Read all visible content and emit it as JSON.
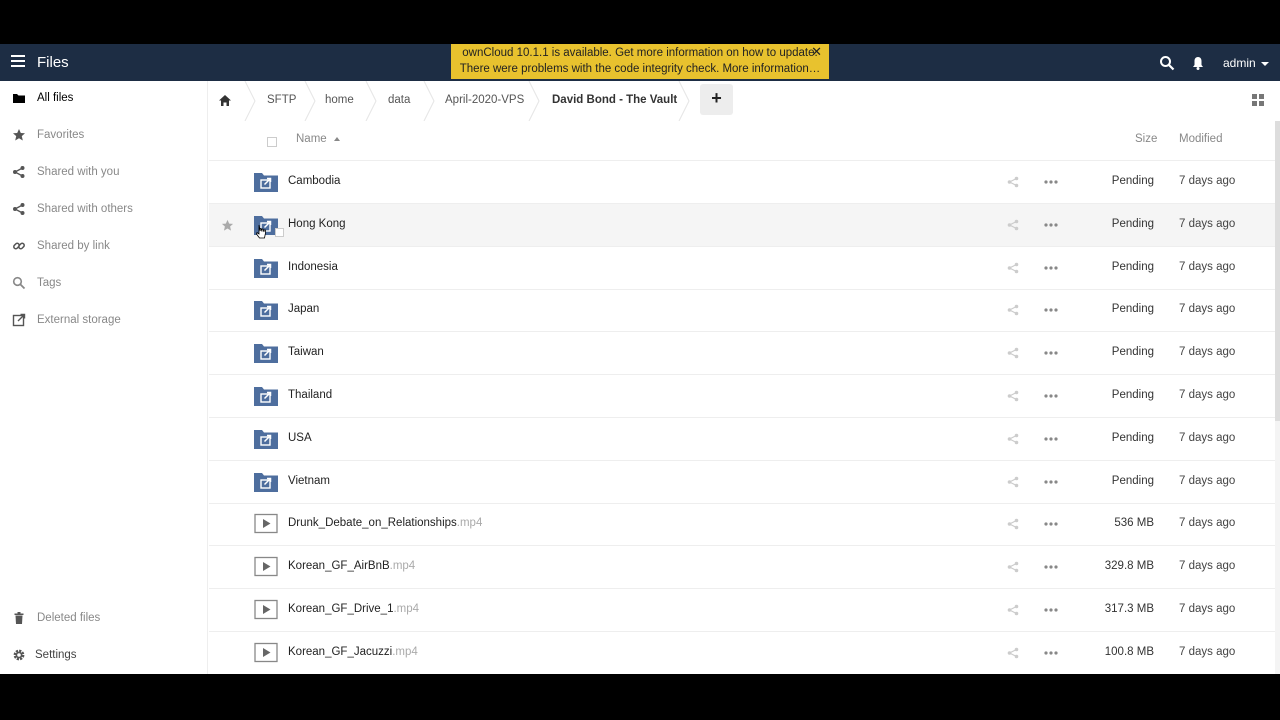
{
  "app": {
    "title": "Files"
  },
  "header": {
    "user": "admin",
    "notice_line1": "ownCloud 10.1.1 is available. Get more information on how to update.",
    "notice_line2": "There were problems with the code integrity check. More information…",
    "close_glyph": "✕"
  },
  "sidebar": {
    "items": [
      {
        "label": "All files",
        "icon": "folder-icon"
      },
      {
        "label": "Favorites",
        "icon": "star-icon"
      },
      {
        "label": "Shared with you",
        "icon": "share-icon"
      },
      {
        "label": "Shared with others",
        "icon": "share-icon"
      },
      {
        "label": "Shared by link",
        "icon": "link-icon"
      },
      {
        "label": "Tags",
        "icon": "search-icon"
      },
      {
        "label": "External storage",
        "icon": "external-icon"
      }
    ],
    "bottom": [
      {
        "label": "Deleted files",
        "icon": "trash-icon"
      },
      {
        "label": "Settings",
        "icon": "gear-icon"
      }
    ]
  },
  "breadcrumb": {
    "items": [
      "SFTP",
      "home",
      "data",
      "April-2020-VPS",
      "David Bond - The Vault"
    ],
    "add_glyph": "+"
  },
  "table": {
    "headers": {
      "name": "Name",
      "size": "Size",
      "modified": "Modified"
    },
    "rows": [
      {
        "name": "Cambodia",
        "ext": "",
        "type": "folder",
        "size": "Pending",
        "modified": "7 days ago"
      },
      {
        "name": "Hong Kong",
        "ext": "",
        "type": "folder",
        "size": "Pending",
        "modified": "7 days ago"
      },
      {
        "name": "Indonesia",
        "ext": "",
        "type": "folder",
        "size": "Pending",
        "modified": "7 days ago"
      },
      {
        "name": "Japan",
        "ext": "",
        "type": "folder",
        "size": "Pending",
        "modified": "7 days ago"
      },
      {
        "name": "Taiwan",
        "ext": "",
        "type": "folder",
        "size": "Pending",
        "modified": "7 days ago"
      },
      {
        "name": "Thailand",
        "ext": "",
        "type": "folder",
        "size": "Pending",
        "modified": "7 days ago"
      },
      {
        "name": "USA",
        "ext": "",
        "type": "folder",
        "size": "Pending",
        "modified": "7 days ago"
      },
      {
        "name": "Vietnam",
        "ext": "",
        "type": "folder",
        "size": "Pending",
        "modified": "7 days ago"
      },
      {
        "name": "Drunk_Debate_on_Relationships",
        "ext": ".mp4",
        "type": "video",
        "size": "536 MB",
        "modified": "7 days ago"
      },
      {
        "name": "Korean_GF_AirBnB",
        "ext": ".mp4",
        "type": "video",
        "size": "329.8 MB",
        "modified": "7 days ago"
      },
      {
        "name": "Korean_GF_Drive_1",
        "ext": ".mp4",
        "type": "video",
        "size": "317.3 MB",
        "modified": "7 days ago"
      },
      {
        "name": "Korean_GF_Jacuzzi",
        "ext": ".mp4",
        "type": "video",
        "size": "100.8 MB",
        "modified": "7 days ago"
      }
    ]
  },
  "colors": {
    "header_bg": "#1d2d44",
    "notice_bg": "#e8c22e",
    "folder_blue": "#4e6e9e"
  }
}
